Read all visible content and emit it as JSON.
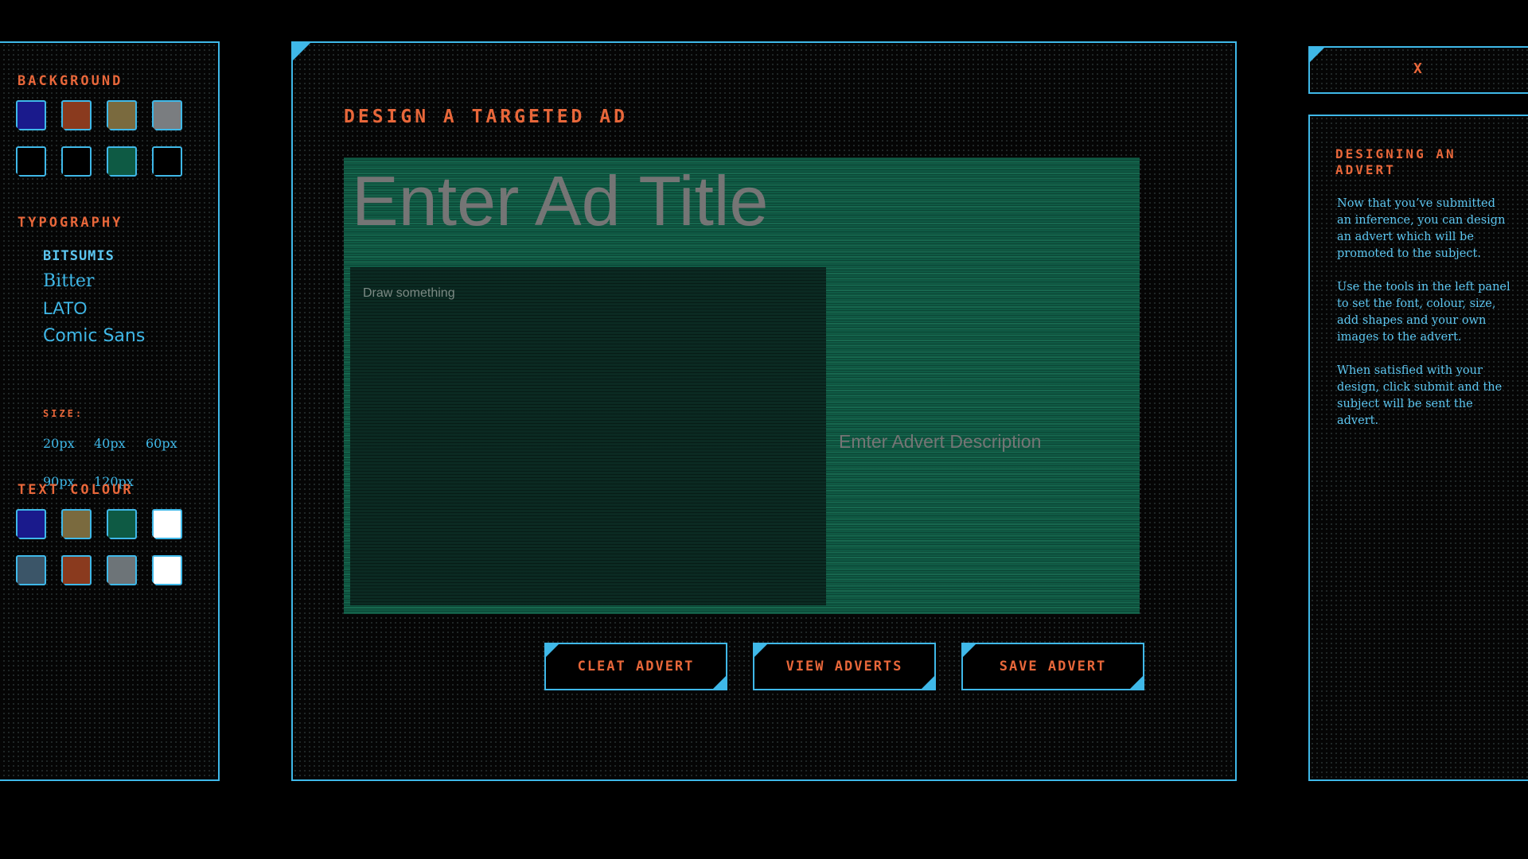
{
  "left_panel": {
    "background_title": "Background",
    "background_swatches": [
      "#1a1a8c",
      "#8a3a1e",
      "#7a6a3e",
      "#7a7d80",
      "#000000",
      "#000000",
      "#0e5a44",
      "#000000"
    ],
    "typography_title": "Typography",
    "fonts": [
      "BITSUMIS",
      "Bitter",
      "LATO",
      "Comic Sans"
    ],
    "size_label": "SIZE:",
    "sizes": [
      "20px",
      "40px",
      "60px",
      "90px",
      "120px"
    ],
    "text_colour_title": "Text Colour",
    "text_colour_swatches": [
      "#1a1a8c",
      "#7a6a3e",
      "#0e5a44",
      "#ffffff",
      "#3b5568",
      "#8a3a1e",
      "#6d7478",
      "#ffffff"
    ]
  },
  "main": {
    "title": "Design a Targeted Ad",
    "ad_title_placeholder": "Enter Ad Title",
    "draw_hint": "Draw something",
    "description_placeholder": "Emter Advert Description",
    "buttons": {
      "clear": "Cleat Advert",
      "view": "View Adverts",
      "save": "Save Advert"
    }
  },
  "right_panel": {
    "close_label": "X",
    "help_title": "Designing an Advert",
    "help_paragraphs": [
      "Now that you’ve submitted an inference, you can design an advert which will be promoted to the subject.",
      "Use the tools in the left panel to set the font, colour, size, add shapes and your own images to the advert.",
      "When satisfied with your design, click submit and the subject will be sent the advert."
    ]
  },
  "colors": {
    "accent_blue": "#3fb8e8",
    "accent_orange": "#e8673a",
    "canvas_green": "#0f5a44"
  }
}
